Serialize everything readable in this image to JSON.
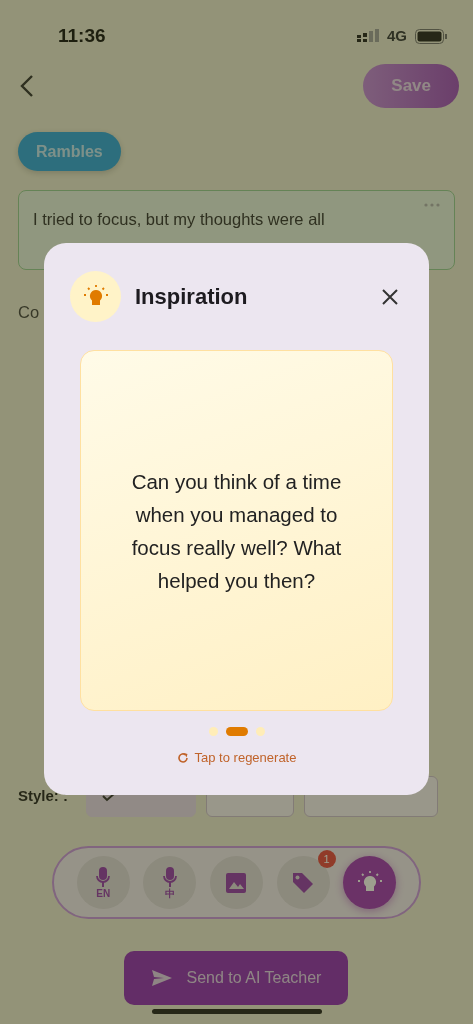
{
  "status_bar": {
    "time": "11:36",
    "network": "4G"
  },
  "header": {
    "save_label": "Save"
  },
  "category": {
    "label": "Rambles"
  },
  "entry": {
    "text": "I tried to focus, but my thoughts were all"
  },
  "section_label": "Co",
  "style": {
    "label": "Style: :",
    "options": [
      {
        "selected": true
      },
      {
        "selected": false
      },
      {
        "selected": false
      }
    ]
  },
  "toolbar": [
    {
      "kind": "mic",
      "caption": "EN",
      "selected": false
    },
    {
      "kind": "mic",
      "caption": "中",
      "selected": false
    },
    {
      "kind": "image",
      "selected": false
    },
    {
      "kind": "tag",
      "badge": "1",
      "selected": false
    },
    {
      "kind": "bulb",
      "selected": true
    }
  ],
  "send_label": "Send to AI Teacher",
  "dialog": {
    "title": "Inspiration",
    "prompt": "Can you think of a time when you managed to focus really well? What helped you then?",
    "pages": [
      {
        "selected": false
      },
      {
        "selected": true
      },
      {
        "selected": false
      }
    ],
    "regenerate_label": "Tap to regenerate"
  }
}
